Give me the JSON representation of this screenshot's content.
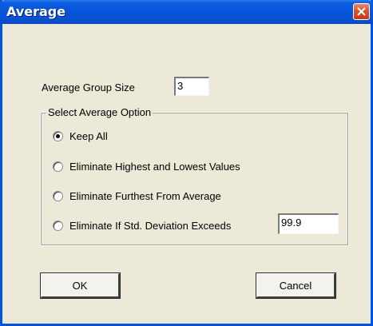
{
  "window": {
    "title": "Average"
  },
  "group_size": {
    "label": "Average Group Size",
    "value": "3"
  },
  "options": {
    "label": "Select Average Option",
    "items": [
      {
        "label": "Keep All",
        "selected": true
      },
      {
        "label": "Eliminate Highest and Lowest Values",
        "selected": false
      },
      {
        "label": "Eliminate Furthest From Average",
        "selected": false
      },
      {
        "label": "Eliminate If Std. Deviation Exceeds",
        "selected": false
      }
    ],
    "std_dev_value": "99.9"
  },
  "buttons": {
    "ok": "OK",
    "cancel": "Cancel"
  },
  "colors": {
    "titlebar": "#0855dd",
    "close": "#d6542f",
    "face": "#ece9d8"
  }
}
